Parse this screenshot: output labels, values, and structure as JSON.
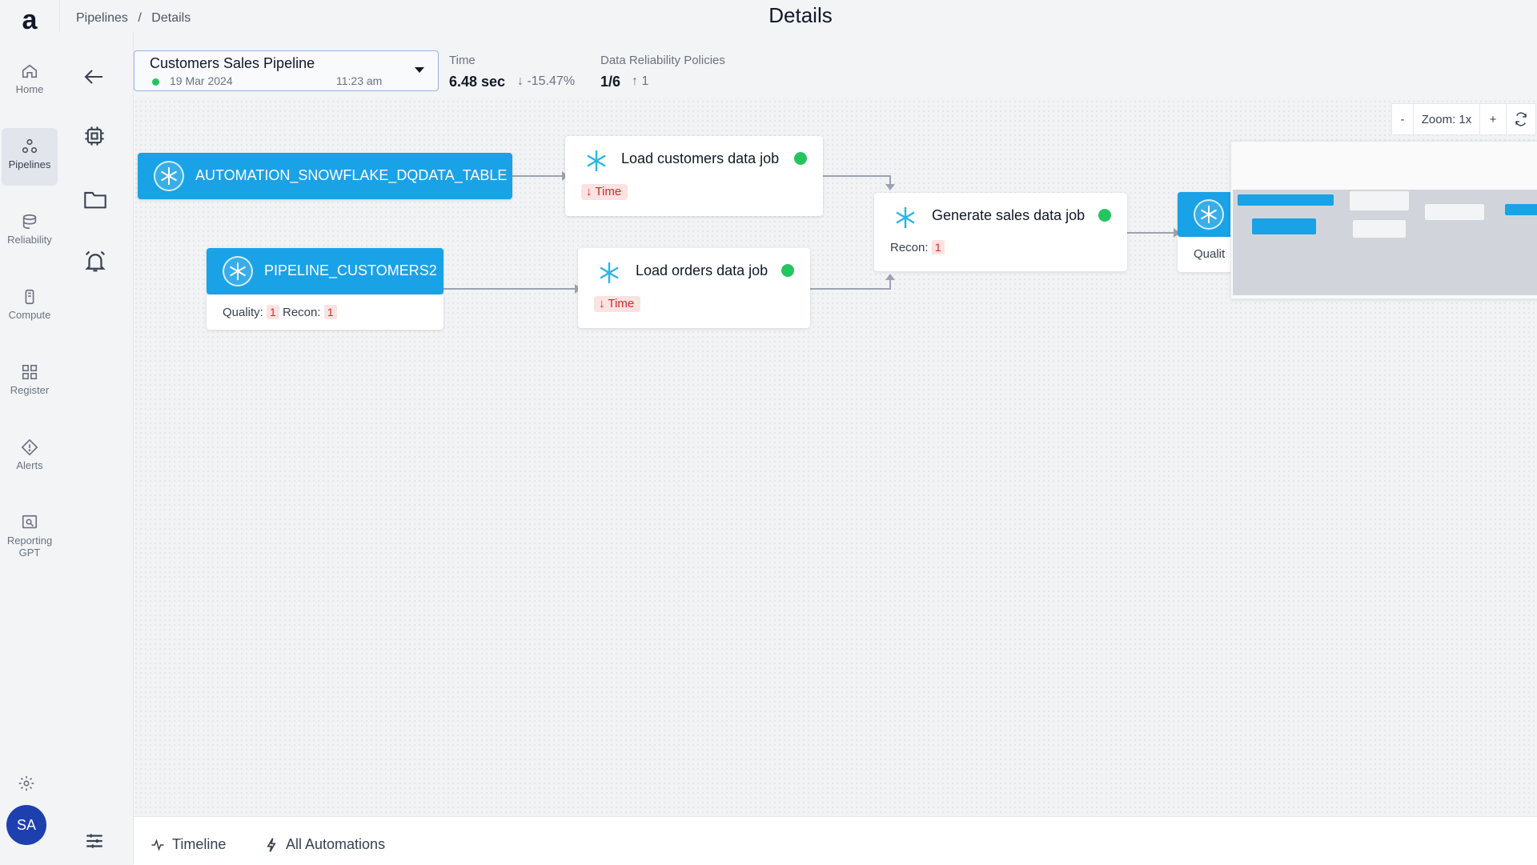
{
  "app": {
    "logo": "a"
  },
  "nav": {
    "items": [
      {
        "label": "Home",
        "icon": "home-icon"
      },
      {
        "label": "Pipelines",
        "icon": "pipelines-icon",
        "active": true
      },
      {
        "label": "Reliability",
        "icon": "reliability-icon"
      },
      {
        "label": "Compute",
        "icon": "compute-icon"
      },
      {
        "label": "Register",
        "icon": "register-icon"
      },
      {
        "label": "Alerts",
        "icon": "alerts-icon"
      },
      {
        "label_line1": "Reporting",
        "label_line2": "GPT",
        "icon": "reporting-gpt-icon"
      }
    ],
    "avatar": "SA"
  },
  "breadcrumb": {
    "root": "Pipelines",
    "sep": "/",
    "current": "Details"
  },
  "page": {
    "title": "Details"
  },
  "pipeline": {
    "name": "Customers Sales Pipeline",
    "date": "19 Mar 2024",
    "time": "11:23 am",
    "status_color": "#22c55e"
  },
  "metrics": {
    "time_label": "Time",
    "time_value": "6.48 sec",
    "time_delta": "-15.47%",
    "policies_label": "Data Reliability Policies",
    "policies_value": "1/6",
    "policies_delta": "1"
  },
  "zoom": {
    "minus": "-",
    "label": "Zoom: 1x",
    "plus": "+"
  },
  "nodes": {
    "table1": {
      "label": "AUTOMATION_SNOWFLAKE_DQDATA_TABLE"
    },
    "table2": {
      "label": "PIPELINE_CUSTOMERS2",
      "quality_label": "Quality:",
      "quality_count": "1",
      "recon_label": "Recon:",
      "recon_count": "1"
    },
    "job1": {
      "label": "Load customers data job",
      "chip": "Time"
    },
    "job2": {
      "label": "Load orders data job",
      "chip": "Time"
    },
    "job3": {
      "label": "Generate sales data job",
      "recon_label": "Recon:",
      "recon_count": "1"
    },
    "partial": {
      "label": "Qualit"
    }
  },
  "bottom": {
    "timeline": "Timeline",
    "automations": "All Automations"
  },
  "colors": {
    "accent": "#1aa2e6",
    "avatar": "#1e40af",
    "success": "#22c55e",
    "alert": "#dc2626"
  }
}
